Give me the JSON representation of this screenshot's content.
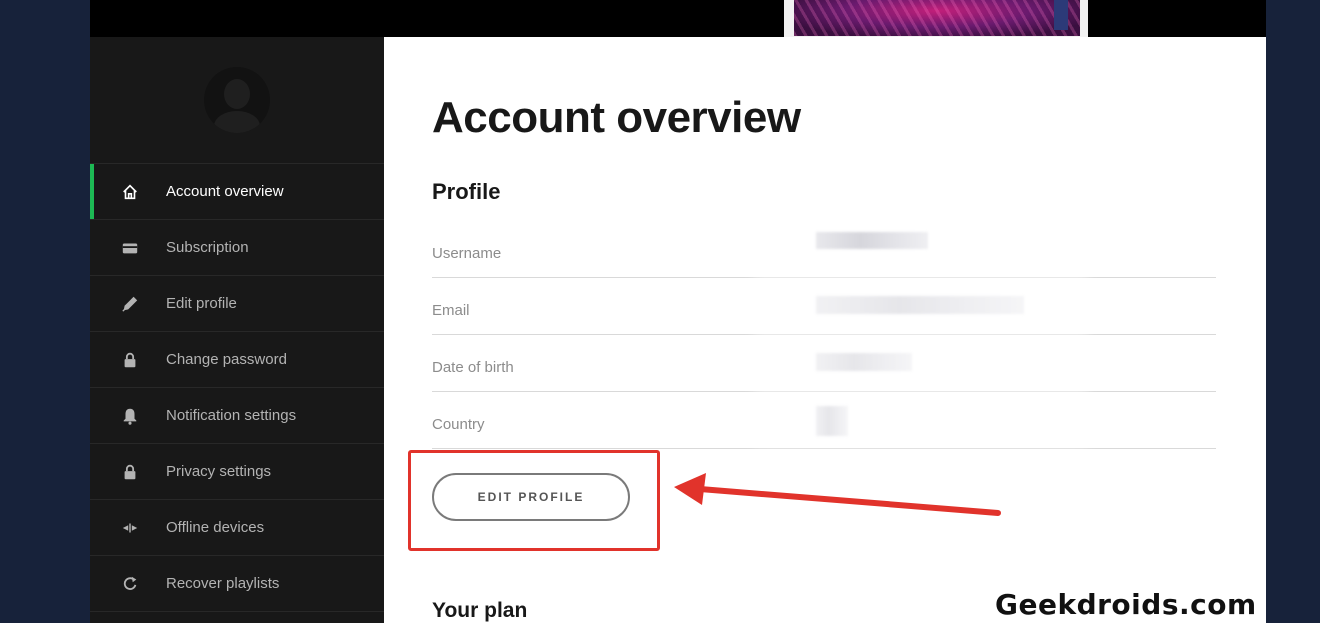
{
  "sidebar": {
    "items": [
      {
        "label": "Account overview",
        "icon": "home-icon",
        "active": true
      },
      {
        "label": "Subscription",
        "icon": "card-icon"
      },
      {
        "label": "Edit profile",
        "icon": "pencil-icon"
      },
      {
        "label": "Change password",
        "icon": "lock-icon"
      },
      {
        "label": "Notification settings",
        "icon": "bell-icon"
      },
      {
        "label": "Privacy settings",
        "icon": "lock-icon"
      },
      {
        "label": "Offline devices",
        "icon": "offline-devices-icon"
      },
      {
        "label": "Recover playlists",
        "icon": "refresh-icon"
      }
    ]
  },
  "main": {
    "title": "Account overview",
    "profile_section": "Profile",
    "fields": [
      {
        "label": "Username"
      },
      {
        "label": "Email"
      },
      {
        "label": "Date of birth"
      },
      {
        "label": "Country"
      }
    ],
    "edit_button": "EDIT PROFILE",
    "plan_section": "Your plan"
  },
  "watermark": "Geekdroids.com",
  "colors": {
    "accent_green": "#1db954",
    "annotation_red": "#e1332b",
    "sidebar_bg": "#181818",
    "page_bg": "#17223a"
  }
}
